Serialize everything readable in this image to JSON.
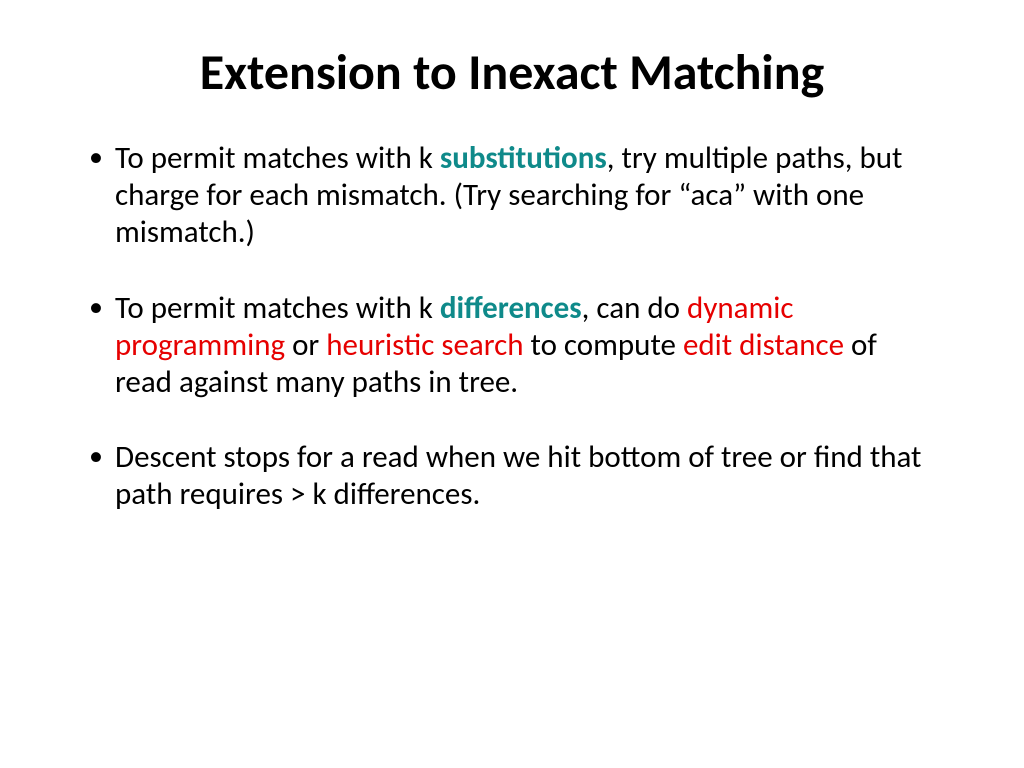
{
  "title": "Extension to Inexact Matching",
  "bullets": {
    "b1": {
      "t1": "To permit matches with k ",
      "kw": "substitutions",
      "t2": ", try multiple paths, but charge for each mismatch. (Try searching for “aca” with one mismatch.)"
    },
    "b2": {
      "t1": "To permit matches with k ",
      "kw": "differences",
      "t2": ", can do ",
      "r1": "dynamic programming",
      "t3": " or ",
      "r2": "heuristic search",
      "t4": " to compute ",
      "r3": "edit distance",
      "t5": " of read against many paths in tree."
    },
    "b3": {
      "t1": "Descent stops for a read when we hit bottom of tree or find that path requires > k differences."
    }
  }
}
